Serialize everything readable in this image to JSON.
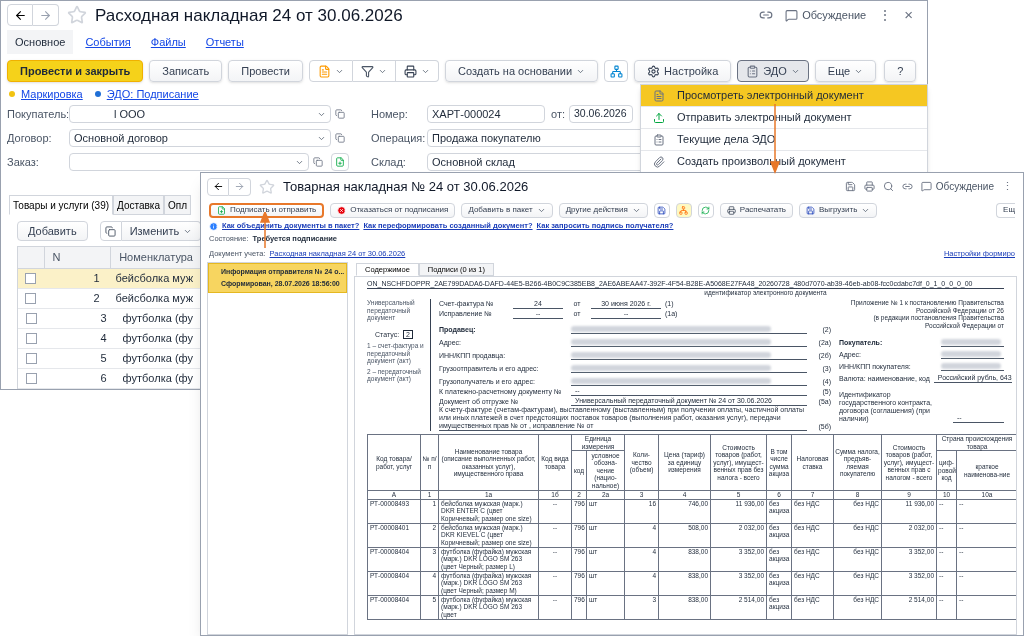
{
  "back_window": {
    "title": "Расходная накладная 24 от 30.06.2026",
    "discussion": "Обсуждение",
    "more": "⋮",
    "close": "×",
    "tabs": [
      {
        "label": "Основное",
        "selected": true
      },
      {
        "label": "События",
        "selected": false
      },
      {
        "label": "Файлы",
        "selected": false
      },
      {
        "label": "Отчеты",
        "selected": false
      }
    ],
    "toolbar": [
      {
        "kind": "primary",
        "label": "Провести и закрыть"
      },
      {
        "kind": "button",
        "label": "Записать"
      },
      {
        "kind": "button",
        "label": "Провести"
      },
      {
        "kind": "icon_group"
      },
      {
        "kind": "dropdown",
        "label": "Создать на основании"
      },
      {
        "kind": "icon_button"
      },
      {
        "kind": "settings",
        "label": "Настройка"
      },
      {
        "kind": "edo",
        "label": "ЭДО",
        "pressed": true
      }
    ],
    "toolbar_right": [
      {
        "kind": "dropdown",
        "label": "Еще"
      },
      {
        "kind": "button",
        "label": "?"
      }
    ],
    "status_links": [
      {
        "label": "Маркировка",
        "color": "#f2c311"
      },
      {
        "label": "ЭДО: Подписание",
        "color": "#1f6fd6"
      }
    ],
    "fields_left": [
      {
        "label": "Покупатель:",
        "value": "l OOO"
      },
      {
        "label": "Договор:",
        "value": "Основной договор"
      },
      {
        "label": "Заказ:"
      }
    ],
    "fields_right": [
      {
        "label": "Номер:",
        "value": "ХАРТ-000024"
      },
      {
        "label": "Операция:",
        "value": "Продажа покупателю"
      },
      {
        "label": "Склад:",
        "value": "Основной склад"
      }
    ],
    "date": {
      "label": "от:",
      "value": "30.06.2026"
    },
    "section_tabs": [
      {
        "label": "Товары и услуги (39)",
        "selected": true
      },
      {
        "label": "Доставка",
        "selected": false
      },
      {
        "label": "Опл",
        "selected": false
      }
    ],
    "table_buttons": {
      "add": "Добавить",
      "edit": "Изменить"
    },
    "table": {
      "columns": [
        "N",
        "Номенклатура"
      ],
      "rows": [
        {
          "n": "1",
          "name": "бейсболка муж",
          "checked": false,
          "selected": true
        },
        {
          "n": "2",
          "name": "бейсболка муж",
          "checked": false,
          "selected": false
        },
        {
          "n": "3",
          "name": "футболка (фу",
          "checked": false,
          "selected": false
        },
        {
          "n": "4",
          "name": "футболка (фу",
          "checked": false,
          "selected": false
        },
        {
          "n": "5",
          "name": "футболка (фу",
          "checked": false,
          "selected": false
        },
        {
          "n": "6",
          "name": "футболка (фу",
          "checked": false,
          "selected": false
        }
      ]
    }
  },
  "edo_menu": [
    {
      "kind": "view",
      "label": "Просмотреть электронный документ",
      "selected": true
    },
    {
      "kind": "send",
      "label": "Отправить электронный документ",
      "selected": false
    },
    {
      "kind": "tasks",
      "label": "Текущие дела ЭДО",
      "selected": false
    },
    {
      "kind": "attach",
      "label": "Создать произвольный документ",
      "selected": false
    }
  ],
  "front_window": {
    "title": "Товарная накладная № 24 от 30.06.2026",
    "discussion": "Обсуждение",
    "more": "⋮",
    "toolbar": [
      {
        "kind": "sign",
        "label": "Подписать и отправить",
        "highlighted": true
      },
      {
        "kind": "cancel",
        "label": "Отказаться от подписания",
        "highlighted": false
      },
      {
        "kind": "dropdown",
        "label": "Добавить в пакет",
        "highlighted": false
      },
      {
        "kind": "dropdown",
        "label": "Другие действия",
        "highlighted": false
      },
      {
        "kind": "save",
        "highlighted": false
      },
      {
        "kind": "tree",
        "highlighted": false
      },
      {
        "kind": "refresh",
        "highlighted": false
      },
      {
        "kind": "print",
        "label": "Распечатать",
        "highlighted": false
      },
      {
        "kind": "export",
        "label": "Выгрузить",
        "highlighted": false
      }
    ],
    "toolbar_right": "Ещ",
    "help_links": [
      "Как объединить документы в пакет?",
      "Как переформировать созданный документ?",
      "Как запросить подпись получателя?"
    ],
    "state": {
      "label": "Состояние:",
      "value": "Требуется подписание"
    },
    "accounting_doc": {
      "label": "Документ учета:",
      "link": "Расходная накладная 24 от 30.06.2026"
    },
    "settings_link": "Настройки формиро",
    "documents": [
      {
        "title": "Информация отправителя № 24 о...",
        "status": "Сформирован, 28.07.2026 18:56:00",
        "selected": true
      }
    ],
    "tabs": [
      {
        "label": "Содержимое",
        "selected": true
      },
      {
        "label": "Подписи (0 из 1)",
        "selected": false
      }
    ],
    "document": {
      "id": "ON_NSCHFDOPPR_2AE799DADA6-DAFD-44E5-B266-4B0C9C385EB8_2AE6ABEAA47-392F-4F54-B28E-A5068E27FA48_20260728_480d7070-ab39-46eb-ab08-fcc0cdabc7df_0_1_0_0_0_00",
      "id_caption": "идентификатор электронного документа",
      "doc_type": "Универсальный передаточный документ",
      "status_label": "Статус:",
      "status": "2",
      "status_note": [
        "1 – счет-фактура и передаточный документ (акт)",
        "2 – передаточный документ (акт)"
      ],
      "appendix": [
        "Приложение № 1 к постановлению Правительства Российской Федерации от 26",
        "(в редакции постановления Правительства Российской Федерации от"
      ],
      "invoice": [
        {
          "label": "Счет-фактура №",
          "number": "24",
          "from": "от",
          "date": "30 июня 2026 г.",
          "code": "(1)"
        },
        {
          "label": "Исправление №",
          "number": "--",
          "from": "от",
          "date": "--",
          "code": "(1а)"
        }
      ],
      "seller_rows": [
        {
          "label": "Продавец:",
          "bold": true,
          "redacted": true,
          "code": "(2)"
        },
        {
          "label": "Адрес:",
          "bold": false,
          "redacted": true,
          "code": "(2а)"
        },
        {
          "label": "ИНН/КПП продавца:",
          "bold": false,
          "redacted": true,
          "code": "(2б)"
        },
        {
          "label": "Грузоотправитель и его адрес:",
          "bold": false,
          "redacted": true,
          "code": "(3)"
        },
        {
          "label": "Грузополучатель и его адрес:",
          "bold": false,
          "redacted": true,
          "code": "(4)"
        },
        {
          "label": "К платежно-расчетному документу №",
          "bold": false,
          "redacted": false,
          "value": "--",
          "code": "(5)"
        },
        {
          "label": "Документ об отгрузке №",
          "bold": false,
          "redacted": false,
          "value": "Универсальный передаточный документ № 24 от 30.06.2026",
          "code": "(5а)"
        }
      ],
      "advance_note": "К счету-фактуре (счетам-фактурам), выставленному (выставленным) при получении оплаты, частичной оплаты или иных платежей в счет предстоящих поставок товаров (выполнения работ, оказания услуг), передачи имущественных прав № от , исправление № от",
      "advance_code": "(5б)",
      "buyer_rows": [
        {
          "label": "Покупатель:",
          "bold": true,
          "redacted": true
        },
        {
          "label": "Адрес:",
          "bold": false,
          "redacted": true
        },
        {
          "label": "ИНН/КПП покупателя:",
          "bold": false,
          "redacted": true
        },
        {
          "label": "Валюта: наименование, код",
          "bold": false,
          "redacted": false,
          "value": "Российский рубль, 643"
        },
        {
          "label": "Идентификатор государственного контракта, договора (соглашения) (при наличии)",
          "bold": false,
          "redacted": false,
          "value": "--"
        }
      ],
      "table": {
        "headers": {
          "code": "Код товара/ работ, услуг",
          "n": "№ п/п",
          "name": "Наименование товара (описание выполненных работ, оказанных услуг), имущественного права",
          "kind": "Код вида товара",
          "unit": "Единица измерения",
          "unit_code": "код",
          "unit_name": "условное обозна-чение (нацио-нальное)",
          "qty": "Коли-чество (объем)",
          "price": "Цена (тариф) за единицу измерения",
          "cost": "Стоимость товаров (работ, услуг), имущест-венных прав без налога - всего",
          "excise": "В том числе сумма акциза",
          "rate": "Налоговая ставка",
          "tax": "Сумма налога, предъяв-ляемая покупателю",
          "total": "Стоимость товаров (работ, услуг), имущест-венных прав с налогом - всего",
          "country": "Страна происхождения товара",
          "country_code": "циф-ровой код",
          "country_name": "краткое наименова-ние"
        },
        "numbers": [
          "А",
          "1",
          "1а",
          "1б",
          "2",
          "2а",
          "3",
          "4",
          "5",
          "6",
          "7",
          "8",
          "9",
          "10",
          "10а"
        ],
        "rows": [
          [
            "РТ-00008493",
            "1",
            "бейсболка мужская (марк.) DKR ENTER C (цвет Коричневый; размер one size)",
            "--",
            "796",
            "шт",
            "16",
            "746,00",
            "11 936,00",
            "без акциза",
            "без НДС",
            "без НДС",
            "11 936,00",
            "--",
            "--"
          ],
          [
            "РТ-00008401",
            "2",
            "бейсболка мужская (марк.) DKR KIEVEL C (цвет Коричневый; размер one size)",
            "--",
            "796",
            "шт",
            "4",
            "508,00",
            "2 032,00",
            "без акциза",
            "без НДС",
            "без НДС",
            "2 032,00",
            "--",
            "--"
          ],
          [
            "РТ-00008404",
            "3",
            "футболка (фуфайка) мужская (марк.) DKR LOGO SM 263 (цвет Черный; размер L)",
            "--",
            "796",
            "шт",
            "4",
            "838,00",
            "3 352,00",
            "без акциза",
            "без НДС",
            "без НДС",
            "3 352,00",
            "--",
            "--"
          ],
          [
            "РТ-00008404",
            "4",
            "футболка (фуфайка) мужская (марк.) DKR LOGO SM 263 (цвет Черный; размер M)",
            "--",
            "796",
            "шт",
            "4",
            "838,00",
            "3 352,00",
            "без акциза",
            "без НДС",
            "без НДС",
            "3 352,00",
            "--",
            "--"
          ],
          [
            "РТ-00008404",
            "5",
            "футболка (фуфайка) мужская (марк.) DKR LOGO SM 263 (цвет",
            "--",
            "796",
            "шт",
            "3",
            "838,00",
            "2 514,00",
            "без акциза",
            "без НДС",
            "без НДС",
            "2 514,00",
            "--",
            "--"
          ]
        ]
      }
    }
  }
}
